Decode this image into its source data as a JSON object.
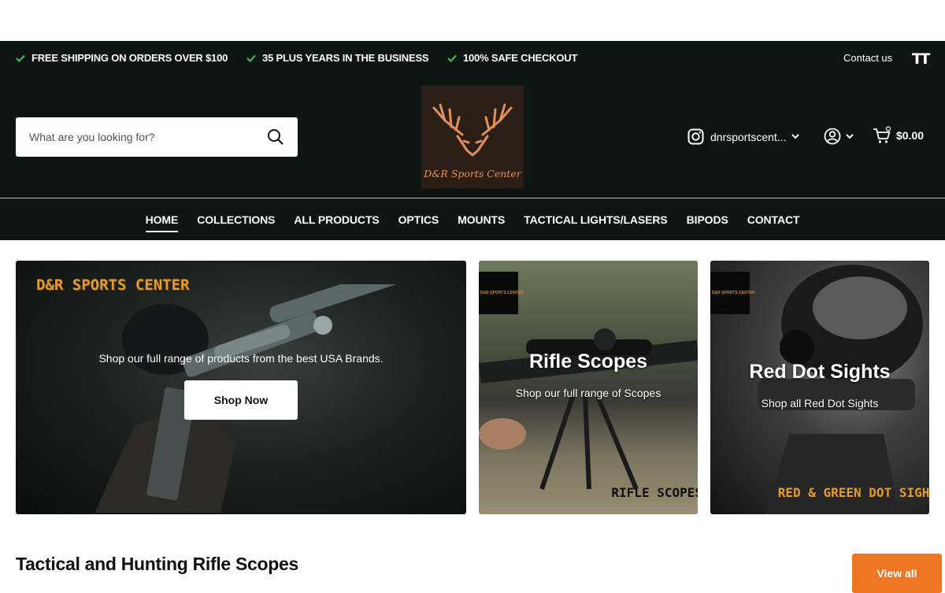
{
  "promo_bar": {
    "items": [
      "FREE SHIPPING ON ORDERS OVER $100",
      "35 PLUS YEARS IN THE BUSINESS",
      "100% SAFE CHECKOUT"
    ],
    "contact_label": "Contact us",
    "text_size_icon_label": "TT"
  },
  "header": {
    "search_placeholder": "What are you looking for?",
    "logo_text": "D&R Sports Center",
    "instagram_label": "dnrsportscent...",
    "cart_total": "$0.00"
  },
  "nav": {
    "items": [
      "HOME",
      "COLLECTIONS",
      "ALL PRODUCTS",
      "OPTICS",
      "MOUNTS",
      "TACTICAL LIGHTS/LASERS",
      "BIPODS",
      "CONTACT"
    ],
    "active": "HOME"
  },
  "tiles": {
    "main": {
      "brand_tag": "D&R SPORTS CENTER",
      "description": "Shop our full range of products from the best USA Brands.",
      "button_label": "Shop Now"
    },
    "rifle_scopes": {
      "title": "Rifle Scopes",
      "subtitle": "Shop our full range of Scopes",
      "footer_text": "RIFLE SCOPES",
      "mini_logo_text": "D&R SPORTS CENTER"
    },
    "red_dot": {
      "title": "Red Dot Sights",
      "subtitle": "Shop all Red Dot Sights",
      "footer_text": "RED & GREEN DOT SIGHT",
      "mini_logo_text": "D&R SPORTS CENTER"
    }
  },
  "section": {
    "title": "Tactical and Hunting Rifle Scopes",
    "view_all_label": "View all"
  },
  "colors": {
    "header_bg": "#0d1613",
    "check_green": "#4bb45a",
    "accent_orange": "#ee7623",
    "brand_gold": "#e39b2a",
    "logo_copper": "#e1925a"
  }
}
